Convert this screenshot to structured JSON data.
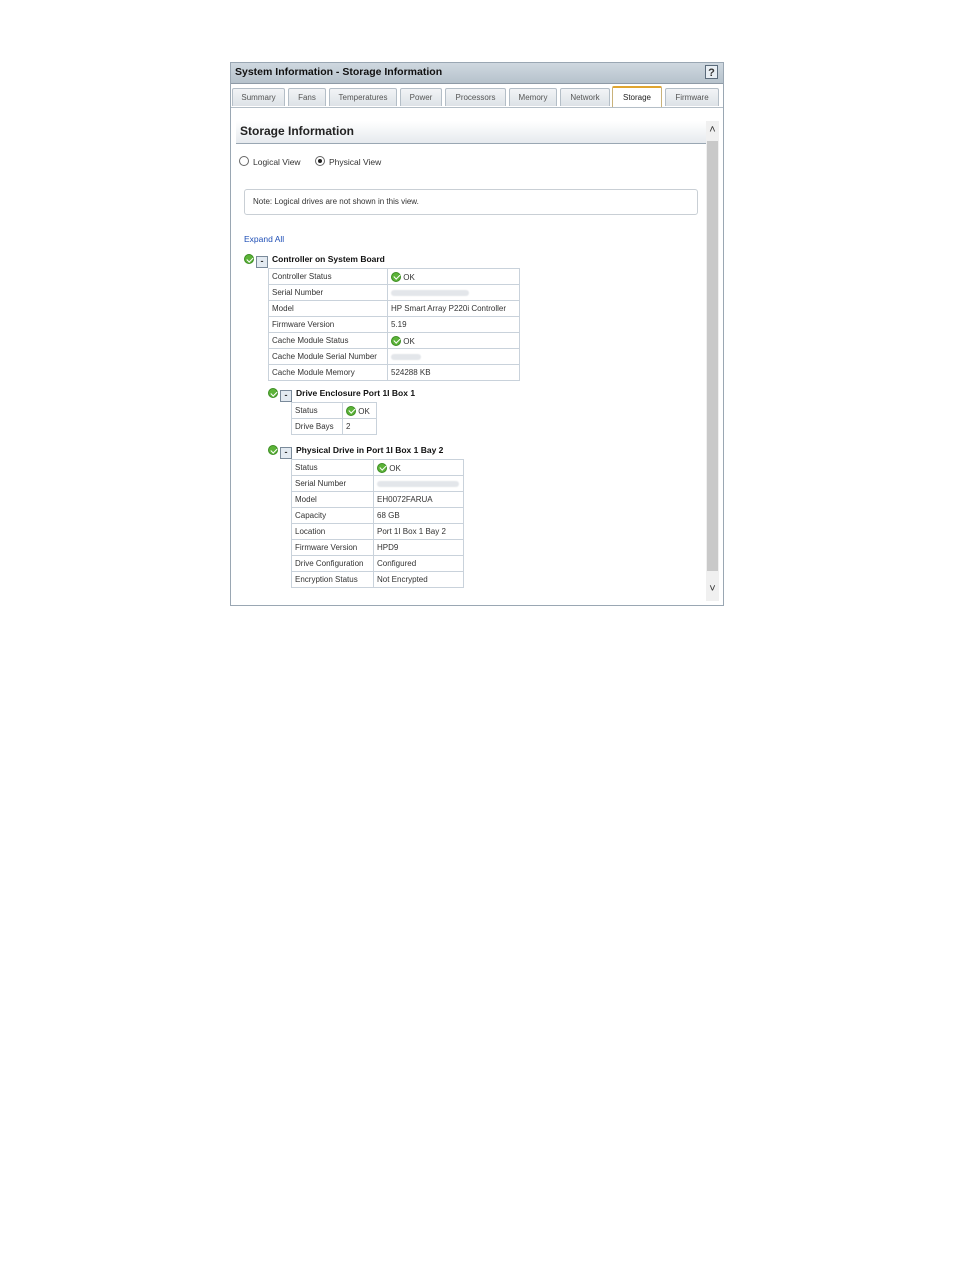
{
  "window": {
    "title": "System Information - Storage Information",
    "help_label": "?"
  },
  "tabs": [
    {
      "label": "Summary"
    },
    {
      "label": "Fans"
    },
    {
      "label": "Temperatures"
    },
    {
      "label": "Power"
    },
    {
      "label": "Processors"
    },
    {
      "label": "Memory"
    },
    {
      "label": "Network"
    },
    {
      "label": "Storage",
      "active": true
    },
    {
      "label": "Firmware"
    }
  ],
  "section": {
    "title": "Storage Information"
  },
  "view_options": {
    "logical": "Logical View",
    "physical": "Physical View",
    "selected": "Physical View"
  },
  "note": "Note: Logical drives are not shown in this view.",
  "expand_all": "Expand All",
  "controller": {
    "title": "Controller on System Board",
    "rows": [
      {
        "label": "Controller Status",
        "value": "OK",
        "status": true
      },
      {
        "label": "Serial Number",
        "value": "",
        "blurred": true
      },
      {
        "label": "Model",
        "value": "HP Smart Array P220i Controller"
      },
      {
        "label": "Firmware Version",
        "value": "5.19"
      },
      {
        "label": "Cache Module Status",
        "value": "OK",
        "status": true
      },
      {
        "label": "Cache Module Serial Number",
        "value": "",
        "blurred": true
      },
      {
        "label": "Cache Module Memory",
        "value": "524288 KB"
      }
    ]
  },
  "enclosure": {
    "title": "Drive Enclosure Port 1I Box 1",
    "rows": [
      {
        "label": "Status",
        "value": "OK",
        "status": true
      },
      {
        "label": "Drive Bays",
        "value": "2"
      }
    ]
  },
  "drive": {
    "title": "Physical Drive in Port 1I Box 1 Bay 2",
    "rows": [
      {
        "label": "Status",
        "value": "OK",
        "status": true
      },
      {
        "label": "Serial Number",
        "value": "",
        "blurred": true
      },
      {
        "label": "Model",
        "value": "EH0072FARUA"
      },
      {
        "label": "Capacity",
        "value": "68 GB"
      },
      {
        "label": "Location",
        "value": "Port 1I Box 1 Bay 2"
      },
      {
        "label": "Firmware Version",
        "value": "HPD9"
      },
      {
        "label": "Drive Configuration",
        "value": "Configured"
      },
      {
        "label": "Encryption Status",
        "value": "Not Encrypted"
      }
    ]
  },
  "colors": {
    "ok_green": "#5cb338",
    "link_blue": "#1f4fb6",
    "active_tab_accent": "#e0a530"
  }
}
